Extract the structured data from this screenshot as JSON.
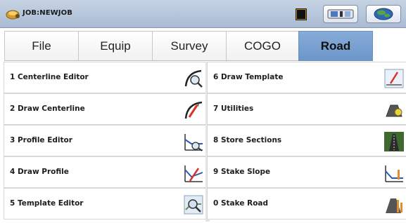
{
  "window": {
    "job_title": "JOB:NEWJOB"
  },
  "tabs": [
    {
      "label": "File",
      "active": false
    },
    {
      "label": "Equip",
      "active": false
    },
    {
      "label": "Survey",
      "active": false
    },
    {
      "label": "COGO",
      "active": false
    },
    {
      "label": "Road",
      "active": true
    }
  ],
  "menu": {
    "left": [
      {
        "label": "1 Centerline Editor",
        "icon": "centerline-editor-icon"
      },
      {
        "label": "2 Draw Centerline",
        "icon": "draw-centerline-icon"
      },
      {
        "label": "3 Profile Editor",
        "icon": "profile-editor-icon"
      },
      {
        "label": "4 Draw Profile",
        "icon": "draw-profile-icon"
      },
      {
        "label": "5 Template Editor",
        "icon": "template-editor-icon"
      }
    ],
    "right": [
      {
        "label": "6 Draw Template",
        "icon": "draw-template-icon"
      },
      {
        "label": "7 Utilities",
        "icon": "utilities-icon"
      },
      {
        "label": "8 Store Sections",
        "icon": "store-sections-icon"
      },
      {
        "label": "9 Stake Slope",
        "icon": "stake-slope-icon"
      },
      {
        "label": "0 Stake Road",
        "icon": "stake-road-icon"
      }
    ]
  },
  "colors": {
    "active_tab": "#7aa2d2",
    "title_bar": "#b7c6db"
  }
}
